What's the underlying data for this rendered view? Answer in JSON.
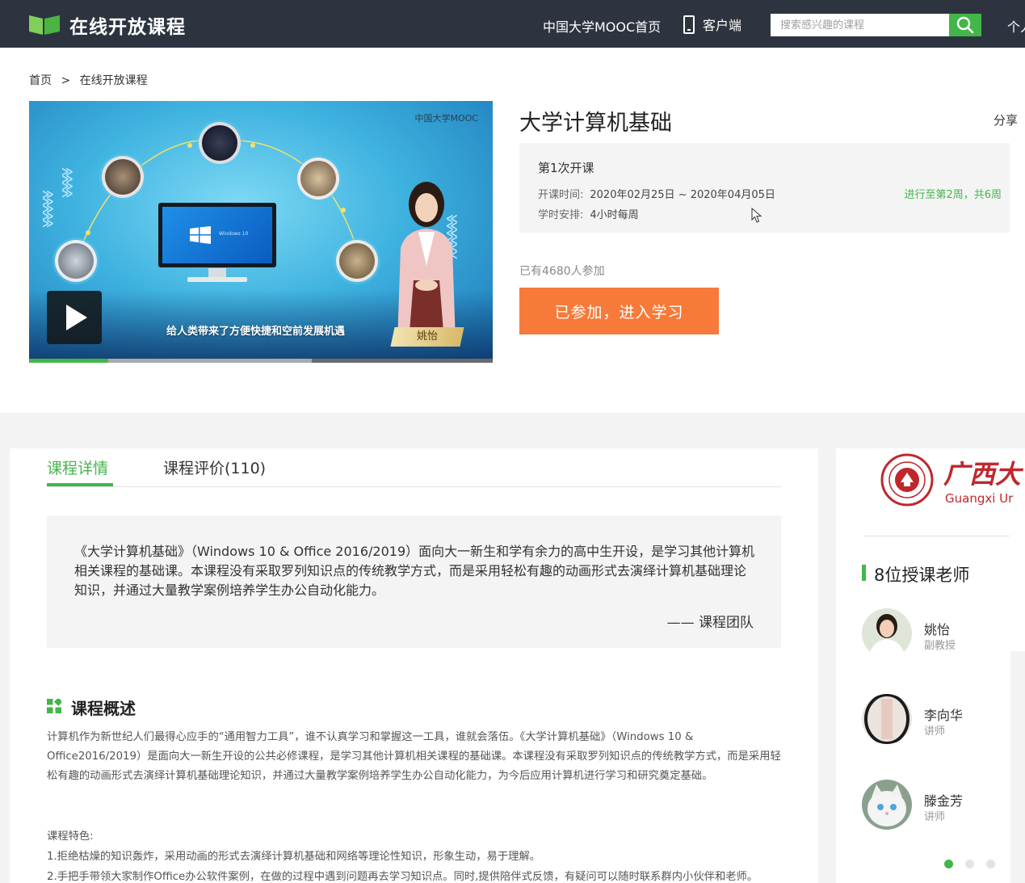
{
  "nav": {
    "site_name": "在线开放课程",
    "home_link": "中国大学MOOC首页",
    "client_link": "客户端",
    "search_placeholder": "搜索感兴趣的课程",
    "personal_link": "个人",
    "colors": {
      "bar": "#2e343f",
      "accent": "#43b649"
    }
  },
  "breadcrumb": {
    "home": "首页",
    "separator": ">",
    "current": "在线开放课程"
  },
  "video": {
    "brand": "中国大学MOOC",
    "screen_label": "Windows 10",
    "caption": "给人类带来了方便快捷和空前发展机遇",
    "presenter_name": "姚怡",
    "played_fraction": 0.17,
    "buffered_fraction": 0.61
  },
  "course": {
    "title": "大学计算机基础",
    "share": "分享",
    "session_name": "第1次开课",
    "time_label": "开课时间:",
    "time_value": "2020年02月25日 ~ 2020年04月05日",
    "schedule_label": "学时安排:",
    "schedule_value": "4小时每周",
    "progress": "进行至第2周，共6周",
    "participants": "已有4680人参加",
    "enter_button": "已参加，进入学习",
    "button_color": "#f77a3a"
  },
  "tabs": [
    {
      "label": "课程详情",
      "active": true
    },
    {
      "label": "课程评价(110)",
      "active": false
    }
  ],
  "intro": {
    "quote": "《大学计算机基础》（Windows 10 & Office 2016/2019）面向大一新生和学有余力的高中生开设，是学习其他计算机相关课程的基础课。本课程没有采取罗列知识点的传统教学方式，而是采用轻松有趣的动画形式去演绎计算机基础理论知识，并通过大量教学案例培养学生办公自动化能力。",
    "signature": "—— 课程团队"
  },
  "overview": {
    "title": "课程概述",
    "text": "计算机作为新世纪人们最得心应手的“通用智力工具”，谁不认真学习和掌握这一工具，谁就会落伍。《大学计算机基础》（Windows 10 & Office2016/2019）是面向大一新生开设的公共必修课程，是学习其他计算机相关课程的基础课。本课程没有采取罗列知识点的传统教学方式，而是采用轻松有趣的动画形式去演绎计算机基础理论知识，并通过大量教学案例培养学生办公自动化能力，为今后应用计算机进行学习和研究奠定基础。",
    "features_title": "课程特色:",
    "features": [
      "1.拒绝枯燥的知识轰炸，采用动画的形式去演绎计算机基础和网络等理论性知识，形象生动，易于理解。",
      "2.手把手带领大家制作Office办公软件案例，在做的过程中遇到问题再去学习知识点。同时,提供陪伴式反馈，有疑问可以随时联系群内小伙伴和老师。"
    ]
  },
  "school": {
    "name_cn": "广西大",
    "name_en": "Guangxi Ur",
    "color": "#c0272d"
  },
  "teachers": {
    "title": "8位授课老师",
    "list": [
      {
        "name": "姚怡",
        "title": "副教授"
      },
      {
        "name": "李向华",
        "title": "讲师"
      },
      {
        "name": "滕金芳",
        "title": "讲师"
      }
    ],
    "pager": {
      "count": 3,
      "active_index": 0
    }
  }
}
